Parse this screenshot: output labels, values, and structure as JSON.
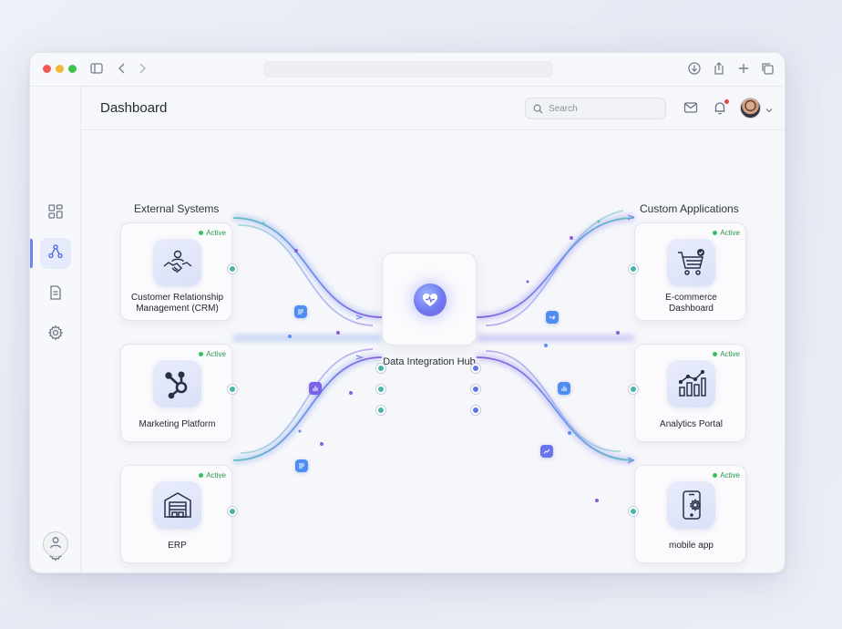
{
  "header": {
    "title": "Dashboard",
    "search_placeholder": "Search"
  },
  "sections": {
    "left_title": "External Systems",
    "right_title": "Custom Applications"
  },
  "external_systems": [
    {
      "label_line1": "Customer Relationship",
      "label_line2": "Management (CRM)",
      "status": "Active",
      "icon": "handshake-icon"
    },
    {
      "label_line1": "Marketing Platform",
      "label_line2": "",
      "status": "Active",
      "icon": "hubspot-icon"
    },
    {
      "label_line1": "ERP",
      "label_line2": "",
      "status": "Active",
      "icon": "warehouse-icon"
    }
  ],
  "custom_applications": [
    {
      "label_line1": "E-commerce",
      "label_line2": "Dashboard",
      "status": "Active",
      "icon": "shopping-cart-icon"
    },
    {
      "label_line1": "Analytics Portal",
      "label_line2": "",
      "status": "Active",
      "icon": "bar-chart-icon"
    },
    {
      "label_line1": "mobile app",
      "label_line2": "",
      "status": "Active",
      "icon": "mobile-settings-icon"
    }
  ],
  "hub": {
    "label": "Data Integration Hub",
    "icon": "heart-hub-icon"
  },
  "colors": {
    "accent": "#5d78e6",
    "flow_teal": "#49b4a8",
    "flow_purple": "#8a5ce0",
    "active_green": "#35c25e"
  }
}
